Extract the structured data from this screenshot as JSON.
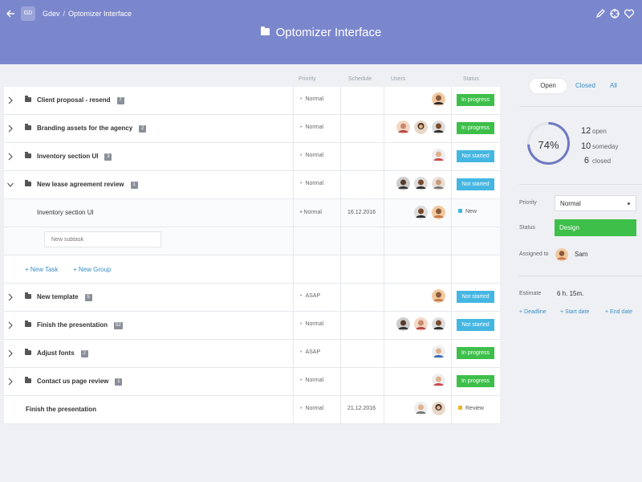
{
  "header": {
    "workspace_initials": "GD",
    "breadcrumb_workspace": "Gdev",
    "breadcrumb_separator": "/",
    "breadcrumb_page": "Optomizer Interface",
    "title": "Optomizer Interface",
    "bg_color": "#7b87cc"
  },
  "table": {
    "columns": {
      "priority": "Priority",
      "schedule": "Schedule",
      "users": "Users",
      "status": "Status"
    },
    "rows": [
      {
        "name": "Client proposal - resend",
        "count": "7",
        "priority": "Normal",
        "schedule": "",
        "status": "In progress"
      },
      {
        "name": "Branding assets for the agency",
        "count": "2",
        "priority": "Normal",
        "schedule": "",
        "status": "In progress"
      },
      {
        "name": "Inventory section UI",
        "count": "3",
        "priority": "Normal",
        "schedule": "",
        "status": "Not started"
      },
      {
        "name": "New lease agreement review",
        "count": "1",
        "priority": "Normal",
        "schedule": "",
        "status": "Not started"
      },
      {
        "name": "New template",
        "count": "5",
        "priority": "ASAP",
        "schedule": "",
        "status": "Not started"
      },
      {
        "name": "Finish the presentation",
        "count": "52",
        "priority": "Normal",
        "schedule": "",
        "status": "Not started"
      },
      {
        "name": "Adjust fonts",
        "count": "2",
        "priority": "ASAP",
        "schedule": "",
        "status": "In progress"
      },
      {
        "name": "Contact us page review",
        "count": "1",
        "priority": "Normal",
        "schedule": "",
        "status": "In progress"
      },
      {
        "name": "Finish the presentation",
        "count": "",
        "priority": "Normal",
        "schedule": "21.12.2016",
        "status": "Review"
      }
    ],
    "subtask": {
      "name": "Inventory section UI",
      "priority": "Normal",
      "schedule": "16.12.2016",
      "status": "New"
    },
    "new_subtask_placeholder": "New subtask",
    "new_task_label": "+ New Task",
    "new_group_label": "+ New Group"
  },
  "sidebar": {
    "tabs": {
      "open": "Open",
      "closed": "Closed",
      "all": "All"
    },
    "progress_percent": 74,
    "progress_label": "74%",
    "stats": [
      {
        "count": "12",
        "label": "open"
      },
      {
        "count": "10",
        "label": "someday"
      },
      {
        "count": "6",
        "label": "closed"
      }
    ],
    "priority_label": "Priority",
    "priority_value": "Normal",
    "status_label": "Status",
    "status_value": "Design",
    "assigned_label": "Assigned to",
    "assignee_name": "Sam",
    "estimate_label": "Estimate",
    "estimate_value": "6 h. 15m.",
    "deadline_link": "+ Deadline",
    "start_date_link": "+ Start date",
    "end_date_link": "+ End date"
  },
  "colors": {
    "in_progress": "#3dbf4a",
    "not_started": "#44b6e2",
    "new": "#44b6e2",
    "review": "#f0b429",
    "link": "#3a8ec5",
    "gauge": "#6f79c2"
  },
  "icons": [
    "back-arrow-icon",
    "pencil-icon",
    "crosshair-icon",
    "heart-icon",
    "folder-icon",
    "chevron-right-icon",
    "chevron-down-icon"
  ]
}
